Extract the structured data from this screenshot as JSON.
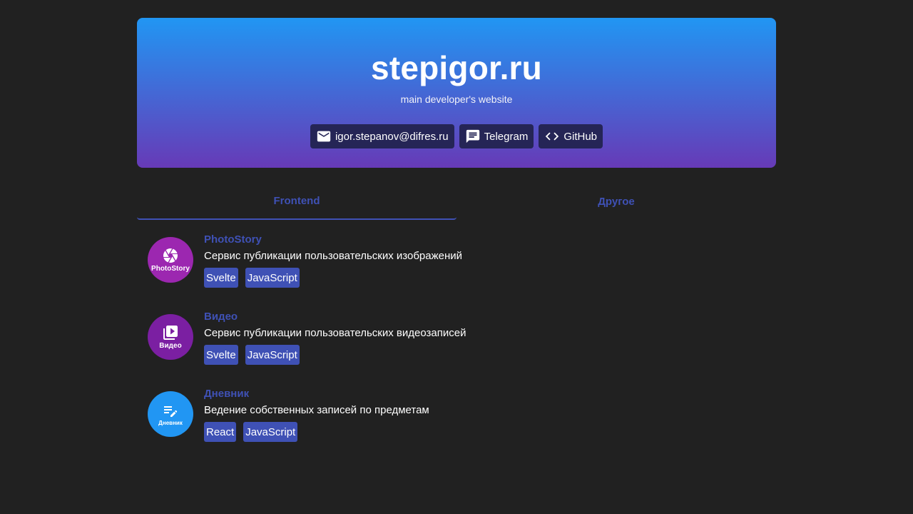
{
  "header": {
    "title": "stepigor.ru",
    "subtitle": "main developer's website",
    "contacts": [
      {
        "label": "igor.stepanov@difres.ru",
        "icon": "mail-icon"
      },
      {
        "label": "Telegram",
        "icon": "chat-icon"
      },
      {
        "label": "GitHub",
        "icon": "code-icon"
      }
    ]
  },
  "tabs": [
    {
      "label": "Frontend",
      "active": true
    },
    {
      "label": "Другое",
      "active": false
    }
  ],
  "projects": [
    {
      "title": "PhotoStory",
      "description": "Сервис публикации пользовательских изображений",
      "icon_label": "PhotoStory",
      "icon": "camera-aperture-icon",
      "color": "#9c27b0",
      "tags": [
        "Svelte",
        "JavaScript"
      ]
    },
    {
      "title": "Видео",
      "description": "Сервис публикации пользовательских видеозаписей",
      "icon_label": "Видео",
      "icon": "video-library-icon",
      "color": "#7b1fa2",
      "tags": [
        "Svelte",
        "JavaScript"
      ]
    },
    {
      "title": "Дневник",
      "description": "Ведение собственных записей по предметам",
      "icon_label": "Дневник",
      "icon": "note-add-icon",
      "color": "#2196f3",
      "tags": [
        "React",
        "JavaScript"
      ]
    }
  ],
  "colors": {
    "background": "#212121",
    "accent": "#3f51b5",
    "gradient_top": "#2196f3",
    "gradient_bottom": "#673ab7",
    "contact_chip": "#252556"
  }
}
